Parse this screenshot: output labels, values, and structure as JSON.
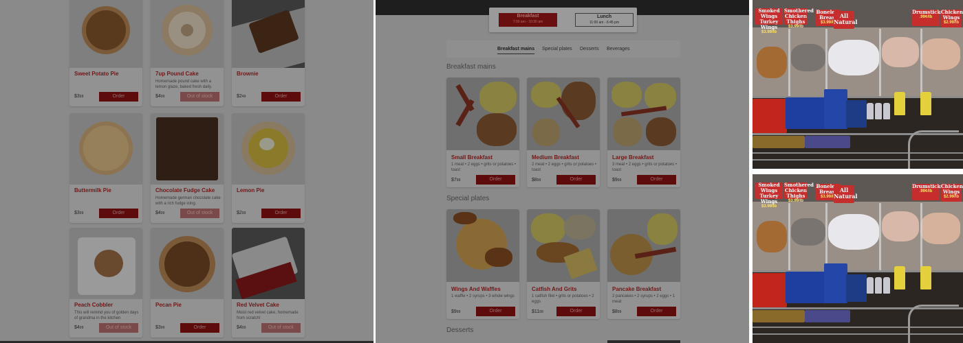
{
  "panel1": {
    "items": [
      {
        "name": "Sweet Potato Pie",
        "desc": "",
        "price": "$3",
        "cents": "99",
        "button": "Order",
        "oos": false
      },
      {
        "name": "7up Pound Cake",
        "desc": "Homemade pound cake with a lemon glaze, baked fresh daily.",
        "price": "$4",
        "cents": "99",
        "button": "Out of stock",
        "oos": true
      },
      {
        "name": "Brownie",
        "desc": "",
        "price": "$2",
        "cents": "49",
        "button": "Order",
        "oos": false
      },
      {
        "name": "Buttermilk Pie",
        "desc": "",
        "price": "$3",
        "cents": "99",
        "button": "Order",
        "oos": false
      },
      {
        "name": "Chocolate Fudge Cake",
        "desc": "Homemade german chocolate cake with a rich fudge icing.",
        "price": "$4",
        "cents": "99",
        "button": "Out of stock",
        "oos": true
      },
      {
        "name": "Lemon Pie",
        "desc": "",
        "price": "$2",
        "cents": "99",
        "button": "Order",
        "oos": false
      },
      {
        "name": "Peach Cobbler",
        "desc": "This will remind you of golden days of grandma in the kitchen",
        "price": "$4",
        "cents": "99",
        "button": "Out of stock",
        "oos": true
      },
      {
        "name": "Pecan Pie",
        "desc": "",
        "price": "$3",
        "cents": "99",
        "button": "Order",
        "oos": false
      },
      {
        "name": "Red Velvet Cake",
        "desc": "Moist red velvet cake, homemade from scratch!",
        "price": "$4",
        "cents": "99",
        "button": "Out of stock",
        "oos": true
      }
    ]
  },
  "panel2": {
    "meals": [
      {
        "label": "Breakfast",
        "hours": "7:00 am - 10:30 am"
      },
      {
        "label": "Lunch",
        "hours": "11:00 am - 6:45 pm"
      }
    ],
    "tabs": [
      "Breakfast mains",
      "Special plates",
      "Desserts",
      "Beverages"
    ],
    "sections": [
      "Breakfast mains",
      "Special plates",
      "Desserts"
    ],
    "items": [
      {
        "name": "Small Breakfast",
        "desc": "1 meat • 2 eggs • grits or potatoes • toast",
        "price": "$7",
        "cents": "99",
        "button": "Order"
      },
      {
        "name": "Medium Breakfast",
        "desc": "2 meat • 2 eggs • grits or potatoes • toast",
        "price": "$8",
        "cents": "99",
        "button": "Order"
      },
      {
        "name": "Large Breakfast",
        "desc": "3 meat • 2 eggs • grits or potatoes • toast",
        "price": "$9",
        "cents": "99",
        "button": "Order"
      },
      {
        "name": "Wings And Waffles",
        "desc": "1 waffle • 2 syrups • 3 whole wings",
        "price": "$9",
        "cents": "99",
        "button": "Order"
      },
      {
        "name": "Catfish And Grits",
        "desc": "1 catfish filet • grits or potatoes • 2 eggs",
        "price": "$11",
        "cents": "99",
        "button": "Order"
      },
      {
        "name": "Pancake Breakfast",
        "desc": "2 pancakes • 2 syrups • 2 eggs • 1 meat",
        "price": "$8",
        "cents": "99",
        "button": "Order"
      }
    ]
  },
  "photo": {
    "signs": [
      {
        "title": "Smoked Wings Turkey Wings",
        "price": "$3.99/lb"
      },
      {
        "title": "Smothered Chicken Thighs",
        "price": "$3.99/lb"
      },
      {
        "title": "Boneless Breast",
        "price": "$3.99/lb"
      },
      {
        "title": "All Natural",
        "price": ""
      },
      {
        "title": "Drumsticks",
        "price": ".99¢/lb"
      },
      {
        "title": "Chicken Wings",
        "price": "$2.99/lb"
      }
    ],
    "icons": [
      "shopping-cart-icon"
    ]
  },
  "colors": {
    "accent": "#5e0b0b",
    "dim": "#8a8a8a",
    "sign": "#c62d2d"
  }
}
